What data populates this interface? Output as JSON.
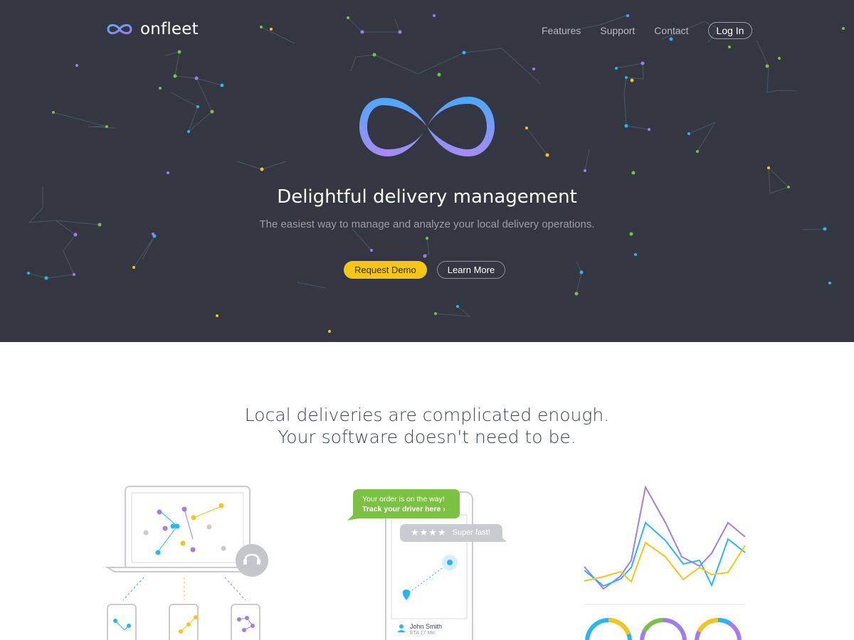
{
  "brand": {
    "name": "onfleet",
    "accent": "#6ea8ff"
  },
  "nav": {
    "features": "Features",
    "support": "Support",
    "contact": "Contact",
    "login": "Log In"
  },
  "hero": {
    "title": "Delightful delivery management",
    "subtitle": "The easiest way to manage and analyze your local delivery operations.",
    "request_demo": "Request Demo",
    "learn_more": "Learn More",
    "background": "#343741",
    "cta_color": "#f5c518"
  },
  "tagline": {
    "line1": "Local deliveries are complicated enough.",
    "line2": "Your software doesn't need to be."
  },
  "phone": {
    "bubble_line1": "Your order is on the way!",
    "bubble_line2": "Track your driver here",
    "rating_stars": "★★★★",
    "rating_text": "Super fast!",
    "driver_name": "John Smith",
    "driver_eta": "ETA 17 Min"
  },
  "icons": [
    "infinity-logo-icon",
    "headset-icon",
    "map-pin-icon",
    "user-icon",
    "chevron-right-icon",
    "star-icon"
  ],
  "colors": {
    "blue": "#29b6f6",
    "purple": "#a07cf0",
    "yellow": "#f5c518",
    "green": "#7cc242",
    "gray": "#c9cbd0"
  }
}
